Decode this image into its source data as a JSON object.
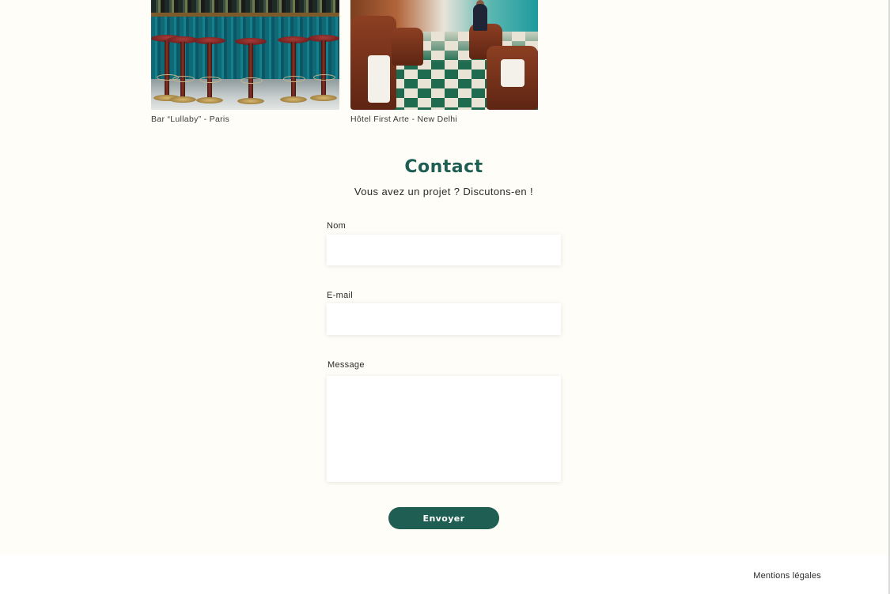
{
  "gallery": {
    "items": [
      {
        "caption": "Bar “Lullaby” - Paris"
      },
      {
        "caption": "Hôtel First Arte - New Delhi"
      }
    ]
  },
  "contact": {
    "title": "Contact",
    "subtitle": "Vous avez un projet ? Discutons-en !",
    "fields": {
      "name": {
        "label": "Nom",
        "value": ""
      },
      "email": {
        "label": "E-mail",
        "value": ""
      },
      "message": {
        "label": "Message",
        "value": ""
      }
    },
    "submit_label": "Envoyer"
  },
  "footer": {
    "legal_link": "Mentions légales"
  },
  "colors": {
    "accent": "#1f5e52",
    "background": "#fffdf7",
    "footer_background": "#ffffff"
  }
}
